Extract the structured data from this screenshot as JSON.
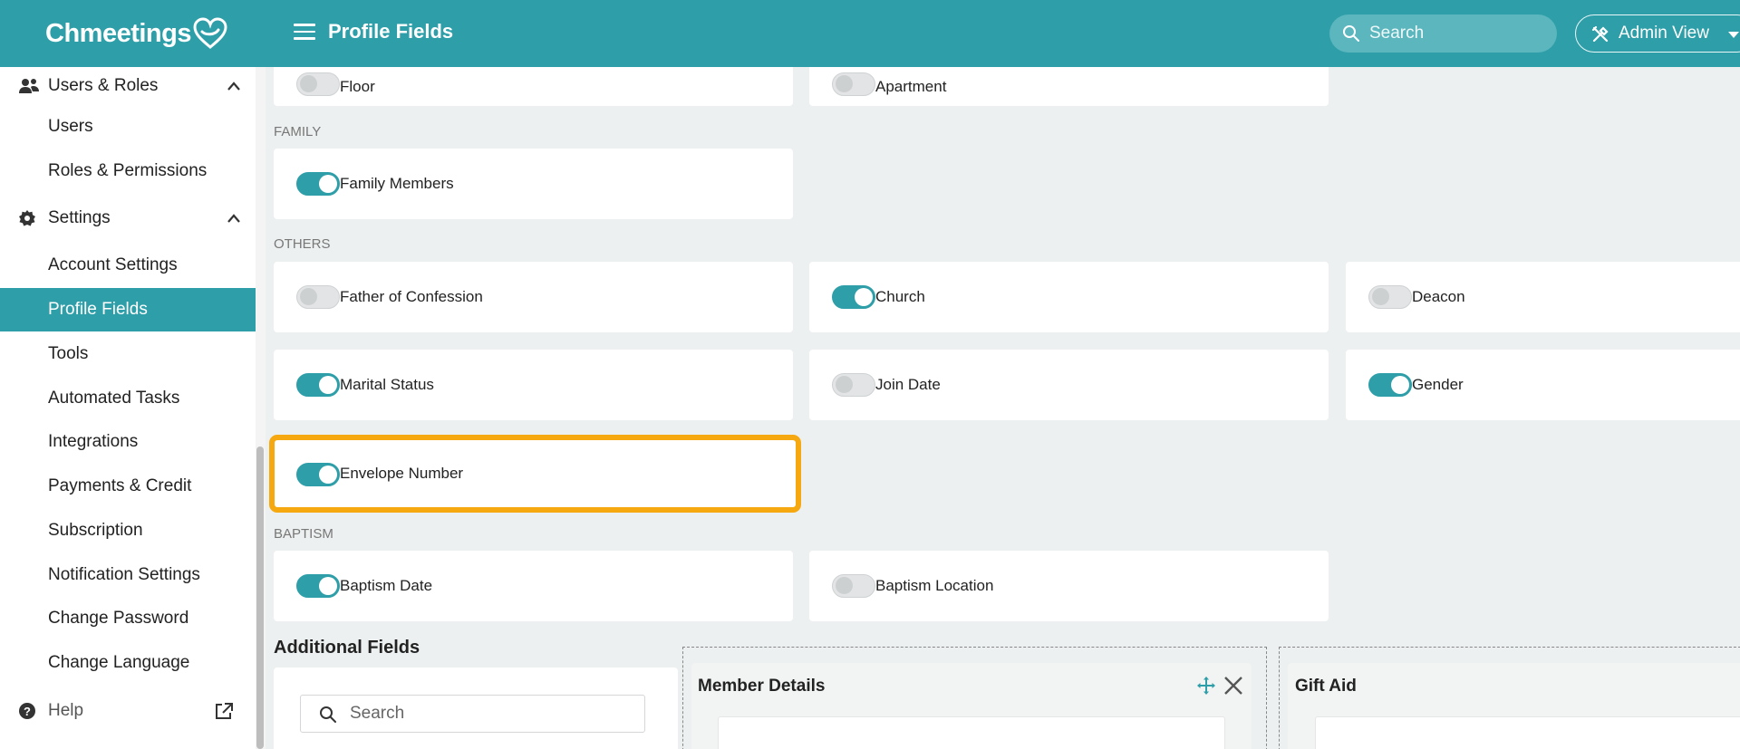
{
  "header": {
    "logo_text": "Chmeetings",
    "title": "Profile Fields",
    "search_placeholder": "Search",
    "admin_view_label": "Admin View"
  },
  "sidebar": {
    "users_roles": {
      "label": "Users & Roles",
      "items": [
        "Users",
        "Roles & Permissions"
      ]
    },
    "settings": {
      "label": "Settings",
      "items": [
        "Account Settings",
        "Profile Fields",
        "Tools",
        "Automated Tasks",
        "Integrations",
        "Payments & Credit",
        "Subscription",
        "Notification Settings",
        "Change Password",
        "Change Language"
      ]
    },
    "active_item": "Profile Fields",
    "help_label": "Help"
  },
  "sections": {
    "top_fields": [
      {
        "label": "Floor",
        "on": false
      },
      {
        "label": "Apartment",
        "on": false
      }
    ],
    "family": {
      "label": "FAMILY",
      "fields": [
        {
          "label": "Family Members",
          "on": true
        }
      ]
    },
    "others": {
      "label": "OTHERS",
      "fields": [
        {
          "label": "Father of Confession",
          "on": false
        },
        {
          "label": "Church",
          "on": true
        },
        {
          "label": "Deacon",
          "on": false
        },
        {
          "label": "Marital Status",
          "on": true
        },
        {
          "label": "Join Date",
          "on": false
        },
        {
          "label": "Gender",
          "on": true
        },
        {
          "label": "Envelope Number",
          "on": true
        }
      ]
    },
    "baptism": {
      "label": "BAPTISM",
      "fields": [
        {
          "label": "Baptism Date",
          "on": true
        },
        {
          "label": "Baptism Location",
          "on": false
        }
      ]
    }
  },
  "additional": {
    "title": "Additional Fields",
    "search_placeholder": "Search",
    "groups": [
      "Member Details",
      "Gift Aid"
    ]
  },
  "colors": {
    "brand": "#2e9ea8",
    "highlight": "#f5a80f"
  }
}
